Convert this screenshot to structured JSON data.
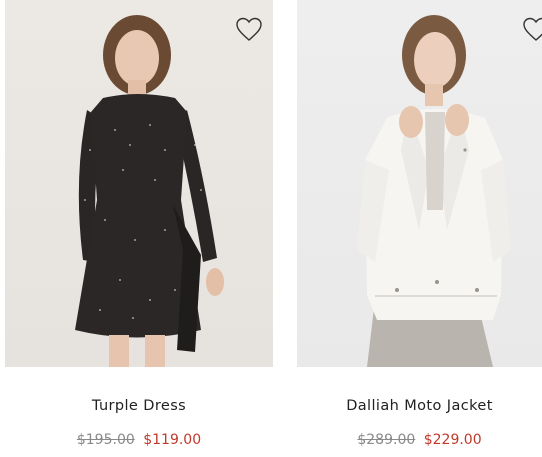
{
  "products": [
    {
      "name": "Turple Dress",
      "original_price": "$195.00",
      "sale_price": "$119.00",
      "wishlist_icon": "heart-outline-icon"
    },
    {
      "name": "Dalliah Moto Jacket",
      "original_price": "$289.00",
      "sale_price": "$229.00",
      "wishlist_icon": "heart-outline-icon"
    }
  ],
  "colors": {
    "sale_price": "#c0392b",
    "original_price": "#8a8a8a",
    "product_name": "#222222",
    "background": "#ffffff"
  }
}
